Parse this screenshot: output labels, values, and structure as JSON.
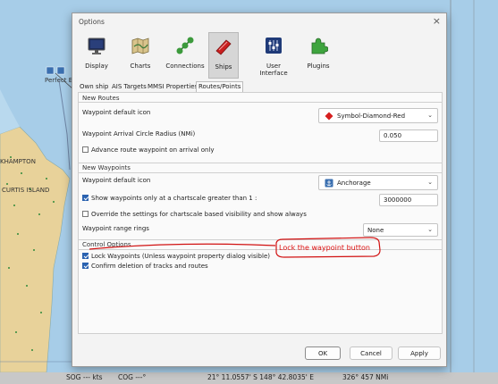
{
  "map": {
    "labels": [
      "Perfect Br",
      "KHAMPTON",
      "CURTIS ISLAND"
    ]
  },
  "status": {
    "sog": "SOG --- kts",
    "cog": "COG ---°",
    "position": "21° 11.0557' S   148° 42.8035' E",
    "bearing": "326°  457 NMi"
  },
  "dialog": {
    "title": "Options",
    "close": "×",
    "toolbar": [
      {
        "label": "Display",
        "icon": "monitor-icon"
      },
      {
        "label": "Charts",
        "icon": "charts-icon"
      },
      {
        "label": "Connections",
        "icon": "connections-icon"
      },
      {
        "label": "Ships",
        "icon": "ships-icon"
      },
      {
        "label": "User Interface",
        "icon": "user-interface-icon"
      },
      {
        "label": "Plugins",
        "icon": "plugins-icon"
      }
    ],
    "tabs": [
      "Own ship",
      "AIS Targets",
      "MMSI Properties",
      "Routes/Points"
    ],
    "new_routes": {
      "title": "New Routes",
      "icon_label": "Waypoint default icon",
      "icon_value": "Symbol-Diamond-Red",
      "radius_label": "Waypoint Arrival Circle Radius (NMi)",
      "radius_value": "0.050",
      "advance_label": "Advance route waypoint on arrival only"
    },
    "new_waypoints": {
      "title": "New Waypoints",
      "icon_label": "Waypoint default icon",
      "icon_value": "Anchorage",
      "show_label": "Show waypoints only at a chartscale greater than 1 :",
      "scale_value": "3000000",
      "override_label": "Override the settings for chartscale based visibility and show always",
      "rings_label": "Waypoint range rings",
      "rings_value": "None"
    },
    "control": {
      "title": "Control Options",
      "lock_label": "Lock Waypoints (Unless waypoint property dialog visible)",
      "confirm_label": "Confirm deletion of tracks and routes"
    },
    "buttons": {
      "ok": "OK",
      "cancel": "Cancel",
      "apply": "Apply"
    }
  },
  "annotation": {
    "text": "Lock the waypoint button",
    "color": "#d11111"
  },
  "colors": {
    "sea": "#a7cde8",
    "land": "#e8d29a",
    "accent": "#2a62b0"
  }
}
